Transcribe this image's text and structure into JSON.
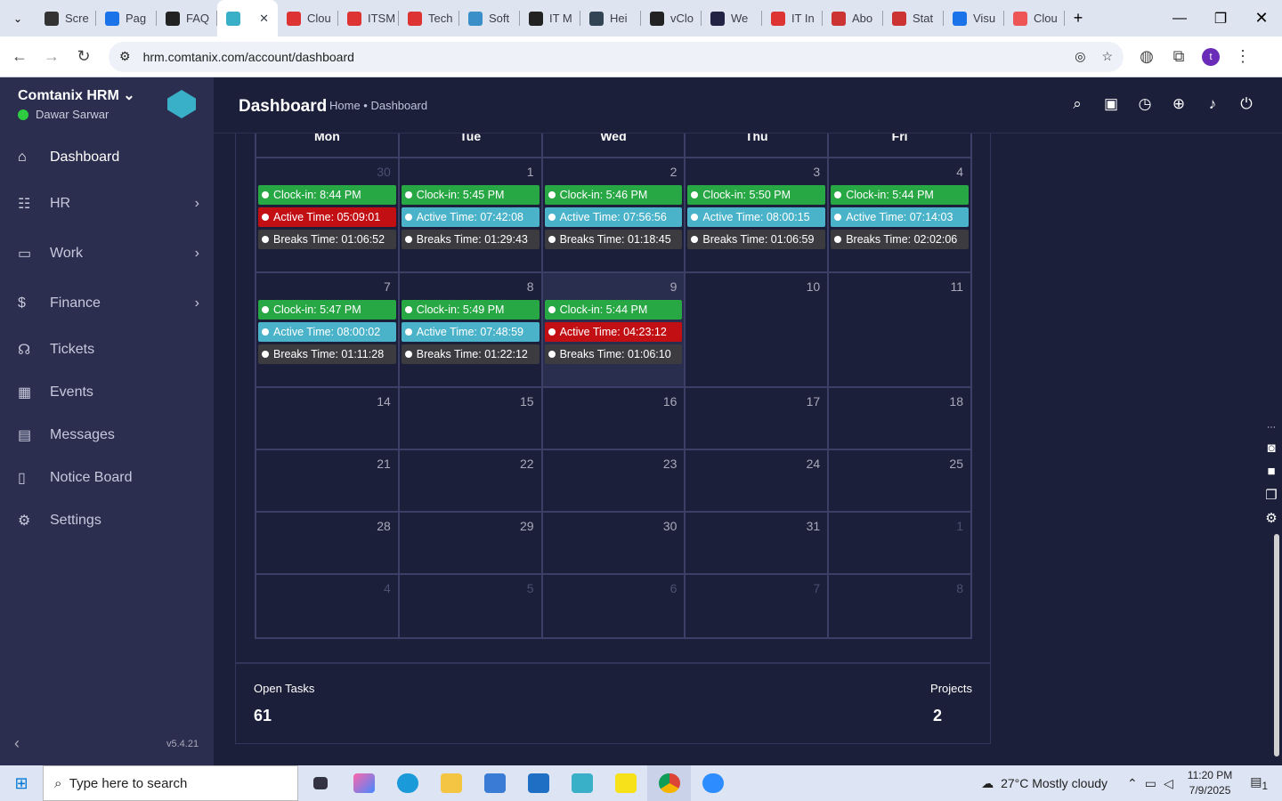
{
  "browser": {
    "tabs": [
      "Scre",
      "Pag",
      "FAQ",
      "",
      "Clou",
      "ITSM",
      "Tech",
      "Soft",
      "IT M",
      "Hei",
      "vClo",
      "We",
      "IT In",
      "Abo",
      "Stat",
      "Visu",
      "Clou"
    ],
    "tab_colors": [
      "#333",
      "#1a73e8",
      "#222",
      "#3ab0c8",
      "#d33",
      "#d33",
      "#d33",
      "#3a8fc8",
      "#222",
      "#345",
      "#222",
      "#224",
      "#d33",
      "#c33",
      "#c33",
      "#1a73e8",
      "#e55"
    ],
    "url": "hrm.comtanix.com/account/dashboard",
    "profile_initial": "t"
  },
  "sidebar": {
    "app_name": "Comtanix HRM",
    "user": "Dawar Sarwar",
    "version": "v5.4.21",
    "items": [
      {
        "label": "Dashboard",
        "icon": "home-icon",
        "glyph": "⌂",
        "chev": ""
      },
      {
        "label": "HR",
        "icon": "users-icon",
        "glyph": "☷",
        "chev": "›"
      },
      {
        "label": "Work",
        "icon": "briefcase-icon",
        "glyph": "▭",
        "chev": "›"
      },
      {
        "label": "Finance",
        "icon": "dollar-icon",
        "glyph": "$",
        "chev": "›"
      },
      {
        "label": "Tickets",
        "icon": "headset-icon",
        "glyph": "☊",
        "chev": ""
      },
      {
        "label": "Events",
        "icon": "calendar-icon",
        "glyph": "▦",
        "chev": ""
      },
      {
        "label": "Messages",
        "icon": "message-icon",
        "glyph": "▤",
        "chev": ""
      },
      {
        "label": "Notice Board",
        "icon": "clipboard-icon",
        "glyph": "▯",
        "chev": ""
      },
      {
        "label": "Settings",
        "icon": "gear-icon",
        "glyph": "⚙",
        "chev": ""
      }
    ]
  },
  "header": {
    "title": "Dashboard",
    "breadcrumb": "Home • Dashboard"
  },
  "calendar": {
    "days": [
      "Mon",
      "Tue",
      "Wed",
      "Thu",
      "Fri"
    ],
    "weeks": [
      [
        {
          "d": "30",
          "m": 1,
          "e": [
            [
              "g",
              "Clock-in: 8:44 PM"
            ],
            [
              "r",
              "Active Time: 05:09:01"
            ],
            [
              "d",
              "Breaks Time: 01:06:52"
            ]
          ]
        },
        {
          "d": "1",
          "e": [
            [
              "g",
              "Clock-in: 5:45 PM"
            ],
            [
              "c",
              "Active Time: 07:42:08"
            ],
            [
              "d",
              "Breaks Time: 01:29:43"
            ]
          ]
        },
        {
          "d": "2",
          "e": [
            [
              "g",
              "Clock-in: 5:46 PM"
            ],
            [
              "c",
              "Active Time: 07:56:56"
            ],
            [
              "d",
              "Breaks Time: 01:18:45"
            ]
          ]
        },
        {
          "d": "3",
          "e": [
            [
              "g",
              "Clock-in: 5:50 PM"
            ],
            [
              "c",
              "Active Time: 08:00:15"
            ],
            [
              "d",
              "Breaks Time: 01:06:59"
            ]
          ]
        },
        {
          "d": "4",
          "e": [
            [
              "g",
              "Clock-in: 5:44 PM"
            ],
            [
              "c",
              "Active Time: 07:14:03"
            ],
            [
              "d",
              "Breaks Time: 02:02:06"
            ]
          ]
        }
      ],
      [
        {
          "d": "7",
          "e": [
            [
              "g",
              "Clock-in: 5:47 PM"
            ],
            [
              "c",
              "Active Time: 08:00:02"
            ],
            [
              "d",
              "Breaks Time: 01:11:28"
            ]
          ]
        },
        {
          "d": "8",
          "e": [
            [
              "g",
              "Clock-in: 5:49 PM"
            ],
            [
              "c",
              "Active Time: 07:48:59"
            ],
            [
              "d",
              "Breaks Time: 01:22:12"
            ]
          ]
        },
        {
          "d": "9",
          "t": 1,
          "e": [
            [
              "g",
              "Clock-in: 5:44 PM"
            ],
            [
              "r",
              "Active Time: 04:23:12"
            ],
            [
              "d",
              "Breaks Time: 01:06:10"
            ]
          ]
        },
        {
          "d": "10",
          "e": []
        },
        {
          "d": "11",
          "e": []
        }
      ],
      [
        {
          "d": "14",
          "e": []
        },
        {
          "d": "15",
          "e": []
        },
        {
          "d": "16",
          "e": []
        },
        {
          "d": "17",
          "e": []
        },
        {
          "d": "18",
          "e": []
        }
      ],
      [
        {
          "d": "21",
          "e": []
        },
        {
          "d": "22",
          "e": []
        },
        {
          "d": "23",
          "e": []
        },
        {
          "d": "24",
          "e": []
        },
        {
          "d": "25",
          "e": []
        }
      ],
      [
        {
          "d": "28",
          "e": []
        },
        {
          "d": "29",
          "e": []
        },
        {
          "d": "30",
          "e": []
        },
        {
          "d": "31",
          "e": []
        },
        {
          "d": "1",
          "m": 1,
          "e": []
        }
      ],
      [
        {
          "d": "4",
          "m": 1,
          "e": []
        },
        {
          "d": "5",
          "m": 1,
          "e": []
        },
        {
          "d": "6",
          "m": 1,
          "e": []
        },
        {
          "d": "7",
          "m": 1,
          "e": []
        },
        {
          "d": "8",
          "m": 1,
          "e": []
        }
      ]
    ]
  },
  "stats": {
    "open_tasks_label": "Open Tasks",
    "open_tasks": "61",
    "projects_label": "Projects",
    "projects": "2"
  },
  "taskbar": {
    "search_placeholder": "Type here to search",
    "weather": "27°C  Mostly cloudy",
    "time": "11:20 PM",
    "date": "7/9/2025",
    "notif_count": "1"
  }
}
